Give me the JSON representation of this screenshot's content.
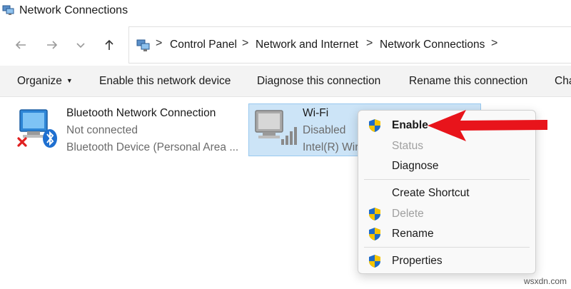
{
  "window": {
    "title": "Network Connections",
    "title_icon": "network-connections-icon"
  },
  "nav": {
    "back_icon": "arrow-left-icon",
    "forward_icon": "arrow-right-icon",
    "history_icon": "chevron-down-icon",
    "up_icon": "arrow-up-icon"
  },
  "breadcrumb": {
    "separator": ">",
    "items": [
      "Control Panel",
      "Network and Internet",
      "Network Connections"
    ]
  },
  "toolbar": {
    "organize": "Organize",
    "enable_device": "Enable this network device",
    "diagnose": "Diagnose this connection",
    "rename": "Rename this connection",
    "overflow": "Cha"
  },
  "connections": [
    {
      "name": "Bluetooth Network Connection",
      "status": "Not connected",
      "device": "Bluetooth Device (Personal Area ...",
      "icon": "bluetooth-network-icon"
    },
    {
      "name": "Wi-Fi",
      "status": "Disabled",
      "device": "Intel(R) Wire",
      "icon": "wifi-network-icon"
    }
  ],
  "context_menu": {
    "items": [
      {
        "label": "Enable",
        "shield": true,
        "bold": true,
        "disabled": false
      },
      {
        "label": "Status",
        "shield": false,
        "bold": false,
        "disabled": true
      },
      {
        "label": "Diagnose",
        "shield": false,
        "bold": false,
        "disabled": false
      },
      {
        "label": "Create Shortcut",
        "shield": false,
        "bold": false,
        "disabled": false
      },
      {
        "label": "Delete",
        "shield": true,
        "bold": false,
        "disabled": true
      },
      {
        "label": "Rename",
        "shield": true,
        "bold": false,
        "disabled": false
      },
      {
        "label": "Properties",
        "shield": true,
        "bold": false,
        "disabled": false
      }
    ]
  },
  "colors": {
    "selection_bg": "#cce4f7",
    "arrow_red": "#e8141b",
    "cmdbar_bg": "#f3f3f3",
    "shield_blue": "#1e6bc8",
    "shield_yellow": "#f5c400"
  },
  "watermark": "wsxdn.com"
}
